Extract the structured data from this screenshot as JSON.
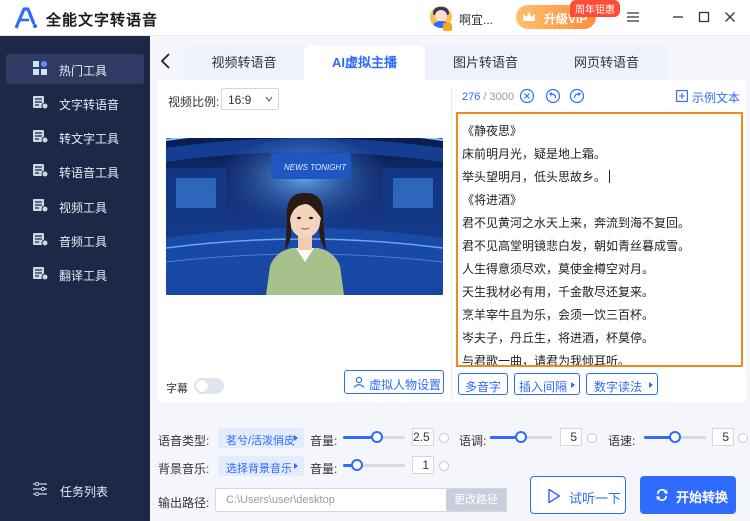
{
  "app": {
    "title": "全能文字转语音",
    "user_name": "啊宜...",
    "vip_label": "升级VIP",
    "promo_badge": "周年钜惠"
  },
  "colors": {
    "accent": "#2f6bff",
    "sidebar_bg": "#1d2747",
    "highlight_border": "#f08a1f"
  },
  "sidebar": {
    "items": [
      {
        "label": "热门工具",
        "icon": "hot-tools-icon",
        "active": true
      },
      {
        "label": "文字转语音",
        "icon": "text-to-speech-icon"
      },
      {
        "label": "转文字工具",
        "icon": "to-text-icon"
      },
      {
        "label": "转语音工具",
        "icon": "to-speech-icon"
      },
      {
        "label": "视频工具",
        "icon": "video-icon"
      },
      {
        "label": "音频工具",
        "icon": "audio-icon"
      },
      {
        "label": "翻译工具",
        "icon": "translate-icon"
      }
    ],
    "task_list": "任务列表"
  },
  "tabs": [
    {
      "label": "视频转语音",
      "active": false
    },
    {
      "label": "AI虚拟主播",
      "active": true
    },
    {
      "label": "图片转语音",
      "active": false
    },
    {
      "label": "网页转语音",
      "active": false
    }
  ],
  "left": {
    "ratio_label": "视频比例:",
    "ratio_value": "16:9",
    "subtitle_label": "字幕",
    "subtitle_on": false,
    "avatar_settings": "虚拟人物设置",
    "preview_screen_text": "NEWS TONIGHT"
  },
  "editor": {
    "count_current": "276",
    "count_max": "/ 3000",
    "sample_text": "示例文本",
    "lines": [
      "《静夜思》",
      "床前明月光，疑是地上霜。",
      "举头望明月，低头思故乡。",
      "《将进酒》",
      "君不见黄河之水天上来，奔流到海不复回。",
      "君不见高堂明镜悲白发，朝如青丝暮成雪。",
      "人生得意须尽欢，莫使金樽空对月。",
      "天生我材必有用，千金散尽还复来。",
      "烹羊宰牛且为乐，会须一饮三百杯。",
      "岑夫子，丹丘生，将进酒，杯莫停。",
      "与君歌一曲，请君为我倾耳听。"
    ],
    "chips": [
      "多音字",
      "插入间隔",
      "数字读法"
    ]
  },
  "settings": {
    "voice_type_label": "语音类型:",
    "voice_type_value": "茗兮/活泼俏皮",
    "volume_label": "音量:",
    "volume_value": "2.5",
    "volume_level": 0.55,
    "tone_label": "语调:",
    "tone_value": "5",
    "tone_level": 0.5,
    "speed_label": "语速:",
    "speed_value": "5",
    "speed_level": 0.5,
    "bgm_label": "背景音乐:",
    "bgm_value": "选择背景音乐",
    "bgm_volume_label": "音量:",
    "bgm_volume_value": "1",
    "bgm_volume_level": 0.22,
    "output_label": "输出路径:",
    "output_path": "C:\\Users\\user\\desktop",
    "change_path": "更改路径",
    "listen_label": "试听一下",
    "start_label": "开始转换"
  }
}
